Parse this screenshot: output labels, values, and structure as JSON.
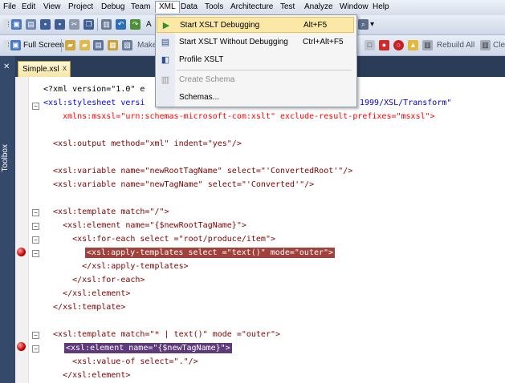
{
  "menubar": {
    "items": [
      "File",
      "Edit",
      "View",
      "Project",
      "Debug",
      "Team",
      "XML",
      "Data",
      "Tools",
      "Architecture",
      "Test",
      "Analyze",
      "Window",
      "Help"
    ]
  },
  "toolbar1": {
    "snippet": "A"
  },
  "toolbar2": {
    "full_screen": "Full Screen",
    "make": "Make",
    "rebuild_all": "Rebuild All",
    "clean": "Cle"
  },
  "toolbox": {
    "label": "Toolbox"
  },
  "editor": {
    "tab_label": "Simple.xsl",
    "tab_close": "x",
    "lines": [
      "<?xml version=\"1.0\" e",
      "<xsl:stylesheet versi",
      "1999/XSL/Transform\"",
      "    xmlns:msxsl=\"urn:schemas-microsoft-com:xslt\" exclude-result-prefixes=\"msxsl\">",
      "",
      "  <xsl:output method=\"xml\" indent=\"yes\"/>",
      "",
      "  <xsl:variable name=\"newRootTagName\" select=\"'ConvertedRoot'\"/>",
      "  <xsl:variable name=\"newTagName\" select=\"'Converted'\"/>",
      "",
      "  <xsl:template match=\"/\">",
      "    <xsl:element name=\"{$newRootTagName}\">",
      "      <xsl:for-each select =\"root/produce/item\">",
      "<xsl:apply-templates select =\"text()\" mode=\"outer\">",
      "        </xsl:apply-templates>",
      "      </xsl:for-each>",
      "    </xsl:element>",
      "  </xsl:template>",
      "",
      "  <xsl:template match=\"* | text()\" mode =\"outer\">",
      "<xsl:element name=\"{$newTagName}\">",
      "      <xsl:value-of select=\".\"/>",
      "    </xsl:element>"
    ]
  },
  "xml_menu": {
    "items": [
      {
        "label": "Start XSLT Debugging",
        "shortcut": "Alt+F5",
        "icon": "play-debug-icon",
        "selected": true,
        "disabled": false
      },
      {
        "label": "Start XSLT Without Debugging",
        "shortcut": "Ctrl+Alt+F5",
        "icon": "run-document-icon",
        "selected": false,
        "disabled": false
      },
      {
        "label": "Profile XSLT",
        "shortcut": "",
        "icon": "profile-icon",
        "selected": false,
        "disabled": false
      },
      {
        "label": "Create Schema",
        "shortcut": "",
        "icon": "schema-icon",
        "selected": false,
        "disabled": true
      },
      {
        "label": "Schemas...",
        "shortcut": "",
        "icon": "",
        "selected": false,
        "disabled": false
      }
    ]
  },
  "colors": {
    "breakpoint": "#c40000",
    "breakpoint_highlight": "#a0413b",
    "current_highlight": "#5d3a79",
    "menu_selection": "#fbe7a6",
    "tab_strip": "#2b3c59"
  }
}
